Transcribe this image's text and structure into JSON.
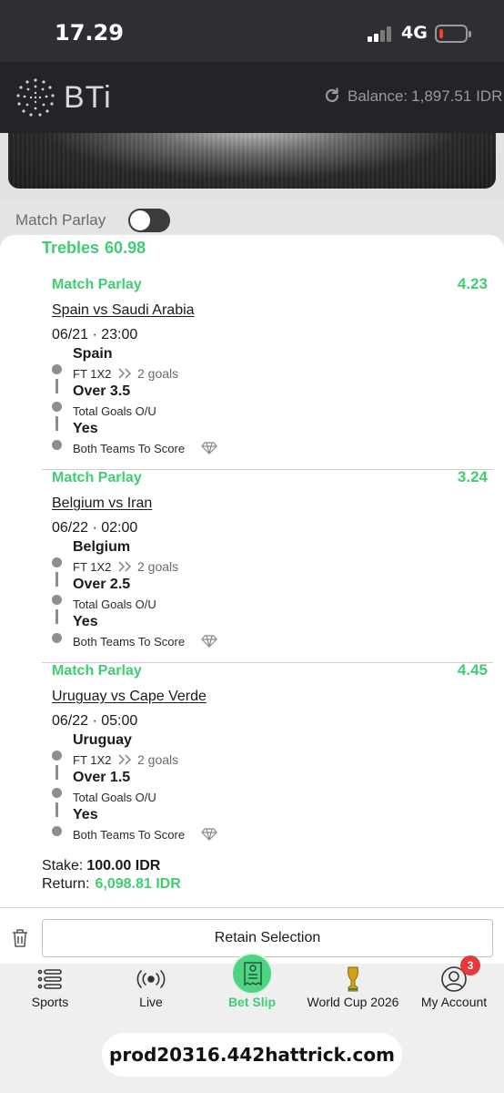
{
  "status_bar": {
    "time": "17.29",
    "network": "4G"
  },
  "header": {
    "logo_text": "BTi",
    "balance_label": "Balance:",
    "balance_value": "1,897.51 IDR"
  },
  "match_parlay_toggle": {
    "label": "Match Parlay",
    "on": false
  },
  "bet_slip": {
    "title": "Trebles",
    "total_odds": "60.98",
    "legs": [
      {
        "type": "Match Parlay",
        "odds": "4.23",
        "teams": "Spain vs Saudi Arabia",
        "datetime": "06/21 · 23:00",
        "selections": [
          {
            "name": "Spain",
            "market": "FT 1X2",
            "extra": "2 goals"
          },
          {
            "name": "Over 3.5",
            "market": "Total Goals O/U"
          },
          {
            "name": "Yes",
            "market": "Both Teams To Score"
          }
        ]
      },
      {
        "type": "Match Parlay",
        "odds": "3.24",
        "teams": "Belgium vs Iran",
        "datetime": "06/22 · 02:00",
        "selections": [
          {
            "name": "Belgium",
            "market": "FT 1X2",
            "extra": "2 goals"
          },
          {
            "name": "Over 2.5",
            "market": "Total Goals O/U"
          },
          {
            "name": "Yes",
            "market": "Both Teams To Score"
          }
        ]
      },
      {
        "type": "Match Parlay",
        "odds": "4.45",
        "teams": "Uruguay vs Cape Verde",
        "datetime": "06/22 · 05:00",
        "selections": [
          {
            "name": "Uruguay",
            "market": "FT 1X2",
            "extra": "2 goals"
          },
          {
            "name": "Over 1.5",
            "market": "Total Goals O/U"
          },
          {
            "name": "Yes",
            "market": "Both Teams To Score"
          }
        ]
      }
    ],
    "stake_label": "Stake:",
    "stake_value": "100.00 IDR",
    "return_label": "Return:",
    "return_value": "6,098.81 IDR",
    "retain_button": "Retain Selection"
  },
  "bottom_nav": {
    "items": [
      {
        "label": "Sports",
        "icon": "sports-list-icon"
      },
      {
        "label": "Live",
        "icon": "live-broadcast-icon"
      },
      {
        "label": "Bet Slip",
        "icon": "bet-slip-receipt-icon"
      },
      {
        "label": "World Cup 2026",
        "icon": "trophy-icon"
      },
      {
        "label": "My Account",
        "icon": "user-icon"
      }
    ],
    "account_badge": "3"
  },
  "browser_url": "prod20316.442hattrick.com",
  "colors": {
    "accent_green": "#3fce72",
    "header_bg": "#222428",
    "badge_red": "#e63a3a"
  }
}
